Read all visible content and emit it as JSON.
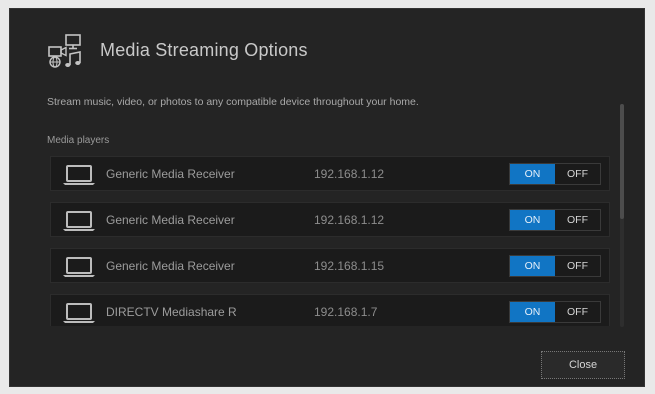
{
  "dialog": {
    "title": "Media Streaming Options",
    "header_icon": "media-streaming-icon",
    "description": "Stream music, video, or photos to any compatible device throughout your home.",
    "section_label": "Media players",
    "close_label": "Close"
  },
  "devices": [
    {
      "name": "Generic Media Receiver",
      "ip": "192.168.1.12",
      "on_label": "ON",
      "off_label": "OFF",
      "enabled": true,
      "icon": "laptop-icon"
    },
    {
      "name": "Generic Media Receiver",
      "ip": "192.168.1.12",
      "on_label": "ON",
      "off_label": "OFF",
      "enabled": true,
      "icon": "laptop-icon"
    },
    {
      "name": "Generic Media Receiver",
      "ip": "192.168.1.15",
      "on_label": "ON",
      "off_label": "OFF",
      "enabled": true,
      "icon": "laptop-icon"
    },
    {
      "name": "DIRECTV Mediashare R",
      "ip": "192.168.1.7",
      "on_label": "ON",
      "off_label": "OFF",
      "enabled": true,
      "icon": "laptop-icon"
    }
  ],
  "colors": {
    "dialog_bg": "#242424",
    "toggle_on": "#1175c4",
    "text_primary": "#c9c9c9"
  }
}
